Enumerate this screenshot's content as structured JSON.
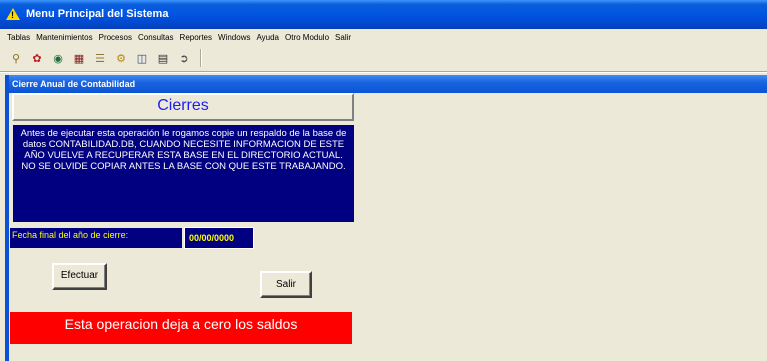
{
  "window": {
    "title": "Menu Principal del Sistema"
  },
  "menu": {
    "items": [
      "Tablas",
      "Mantenimientos",
      "Procesos",
      "Consultas",
      "Reportes",
      "Windows",
      "Ayuda",
      "Otro Modulo",
      "Salir"
    ]
  },
  "toolbar": {
    "icons": [
      "search-icon",
      "record-icon",
      "disk-icon",
      "table-icon",
      "list-icon",
      "settings-icon",
      "tree-icon",
      "window-icon",
      "exit-icon"
    ]
  },
  "child": {
    "title": "Cierre Anual de Contabilidad",
    "heading": "Cierres",
    "warning_text": "Antes de ejecutar esta operación le rogamos copie un respaldo de la base de datos CONTABILIDAD.DB, CUANDO NECESITE INFORMACION DE ESTE AÑO VUELVE A RECUPERAR ESTA BASE EN EL DIRECTORIO ACTUAL. NO SE OLVIDE COPIAR ANTES LA BASE CON QUE ESTE TRABAJANDO.",
    "date_label": "Fecha final del año de cierre:",
    "date_value": "00/00/0000",
    "btn_efectuar": "Efectuar",
    "btn_salir": "Salir",
    "alert": "Esta operacion deja a cero los saldos"
  },
  "colors": {
    "title_bar": "#0054e3",
    "panel_bg": "#000080",
    "accent_text": "#ffff00",
    "alert_bg": "#ff0000",
    "heading_text": "#1b1ef5"
  }
}
